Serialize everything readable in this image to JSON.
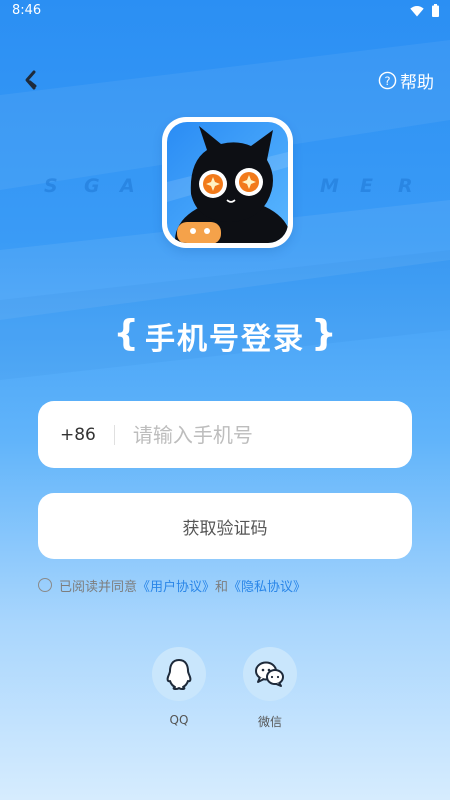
{
  "status_bar": {
    "time": "8:46"
  },
  "header": {
    "help_label": "帮助"
  },
  "brand": {
    "letters": [
      "S",
      "G",
      "A",
      "M",
      "E",
      "R"
    ]
  },
  "page_title": "手机号登录",
  "phone_form": {
    "country_code": "+86",
    "placeholder": "请输入手机号",
    "value": ""
  },
  "get_code_button": "获取验证码",
  "agreement": {
    "prefix": "已阅读并同意",
    "user_agreement": "《用户协议》",
    "conjunction": "和",
    "privacy_policy": "《隐私协议》"
  },
  "social_login": [
    {
      "icon": "qq-icon",
      "label": "QQ"
    },
    {
      "icon": "wechat-icon",
      "label": "微信"
    }
  ],
  "colors": {
    "link": "#2a86e8",
    "background_top": "#2b8ff3",
    "background_bottom": "#d6ecfe",
    "social_circle": "#c9e6fc"
  }
}
